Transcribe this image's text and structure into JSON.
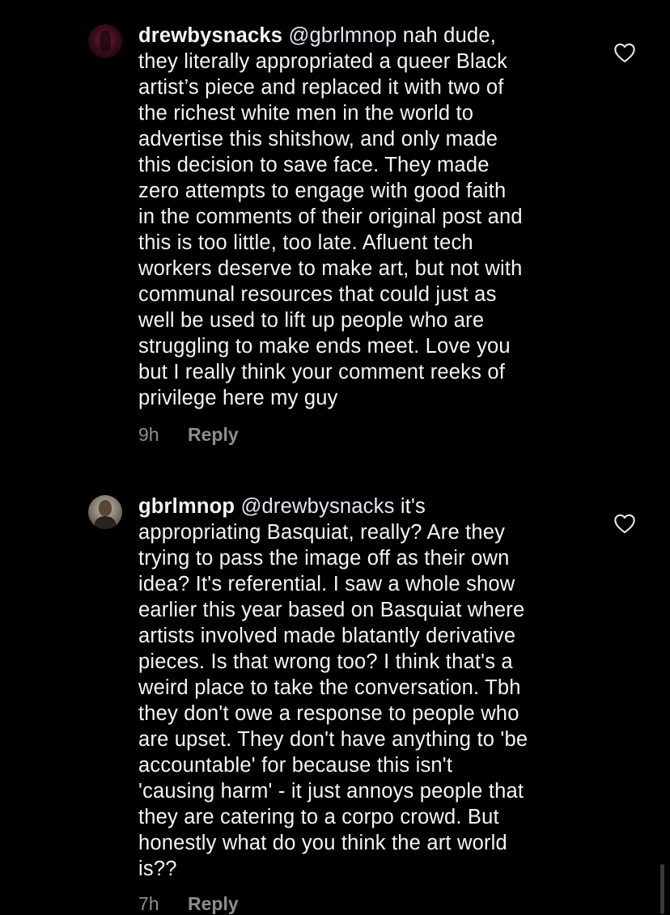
{
  "comments": [
    {
      "username": "drewbysnacks",
      "mention": "@gbrlmnop",
      "body": " nah dude,\nthey literally appropriated a queer Black\nartist’s piece and replaced it with two of\nthe richest white men in the world to\nadvertise this shitshow, and only made\nthis decision to save face. They made\nzero attempts to engage with good faith\nin the comments of their original post and\nthis is too little, too late. Afluent tech\nworkers deserve to make art, but not with\ncommunal resources that could just as\nwell be used to lift up people who are\nstruggling to make ends meet. Love you\nbut I really think your comment reeks of\nprivilege here my guy",
      "time": "9h",
      "reply_label": "Reply",
      "icon": "heart-outline-icon"
    },
    {
      "username": "gbrlmnop",
      "mention": "@drewbysnacks",
      "body": " it's\nappropriating Basquiat, really? Are they\ntrying to pass the image off as their own\nidea? It's referential. I saw a whole show\nearlier this year based on Basquiat where\nartists involved made blatantly derivative\npieces. Is that wrong too? I think that's a\nweird place to take the conversation. Tbh\nthey don't owe a response to people who\nare upset. They don't have anything to 'be\naccountable' for because this isn't\n'causing harm' - it just annoys people that\nthey are catering to a corpo crowd. But\nhonestly what do you think the art world\nis??",
      "time": "7h",
      "reply_label": "Reply",
      "icon": "heart-outline-icon"
    }
  ],
  "colors": {
    "background": "#000000",
    "text": "#f5f5f5",
    "meta": "#8e8e8e"
  }
}
